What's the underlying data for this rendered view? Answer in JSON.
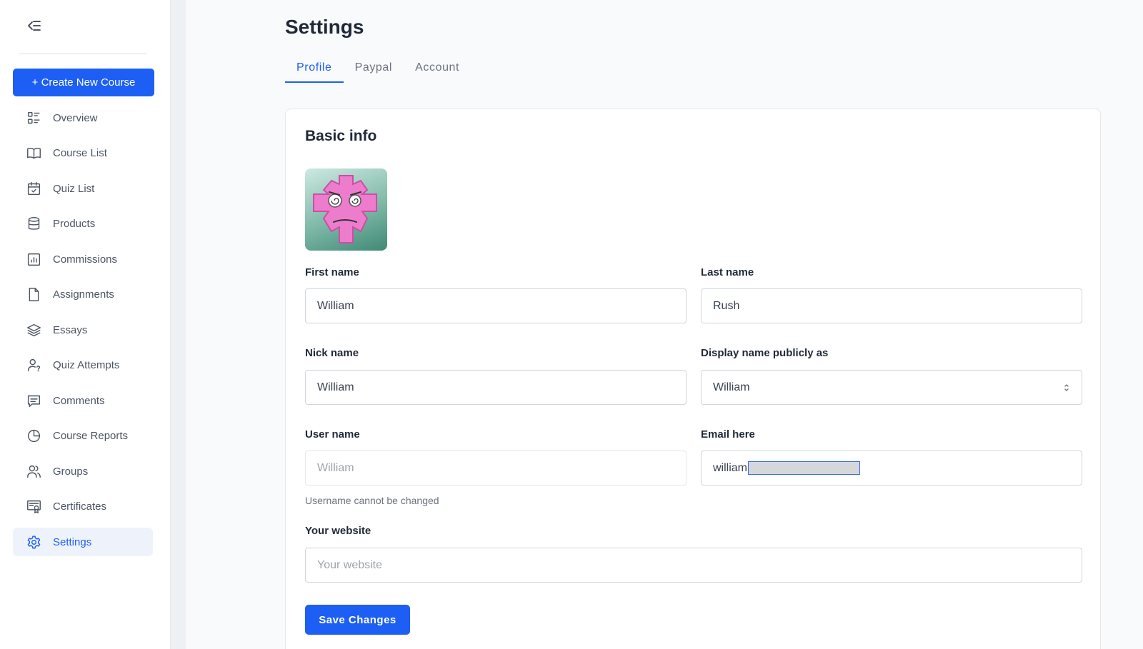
{
  "sidebar": {
    "create_button_label": "+ Create New Course",
    "items": [
      {
        "label": "Overview",
        "icon": "overview-icon"
      },
      {
        "label": "Course List",
        "icon": "book-icon"
      },
      {
        "label": "Quiz List",
        "icon": "calendar-check-icon"
      },
      {
        "label": "Products",
        "icon": "database-icon"
      },
      {
        "label": "Commissions",
        "icon": "bar-chart-icon"
      },
      {
        "label": "Assignments",
        "icon": "file-icon"
      },
      {
        "label": "Essays",
        "icon": "layers-icon"
      },
      {
        "label": "Quiz Attempts",
        "icon": "user-question-icon"
      },
      {
        "label": "Comments",
        "icon": "comment-icon"
      },
      {
        "label": "Course Reports",
        "icon": "pie-chart-icon"
      },
      {
        "label": "Groups",
        "icon": "users-icon"
      },
      {
        "label": "Certificates",
        "icon": "certificate-icon"
      },
      {
        "label": "Settings",
        "icon": "gear-icon",
        "active": true
      }
    ]
  },
  "page": {
    "title": "Settings",
    "tabs": [
      {
        "label": "Profile",
        "active": true
      },
      {
        "label": "Paypal",
        "active": false
      },
      {
        "label": "Account",
        "active": false
      }
    ]
  },
  "card": {
    "title": "Basic info",
    "fields": {
      "first_name": {
        "label": "First name",
        "value": "William"
      },
      "last_name": {
        "label": "Last name",
        "value": "Rush"
      },
      "nick_name": {
        "label": "Nick name",
        "value": "William"
      },
      "display_name": {
        "label": "Display name publicly as",
        "value": "William"
      },
      "user_name": {
        "label": "User name",
        "placeholder": "William",
        "hint": "Username cannot be changed"
      },
      "email": {
        "label": "Email here",
        "value": "william"
      },
      "website": {
        "label": "Your website",
        "placeholder": "Your website"
      }
    },
    "save_label": "Save Changes"
  },
  "colors": {
    "accent": "#1d5ff5",
    "active_bg": "#eef3fb",
    "page_bg": "#f9fafc"
  }
}
